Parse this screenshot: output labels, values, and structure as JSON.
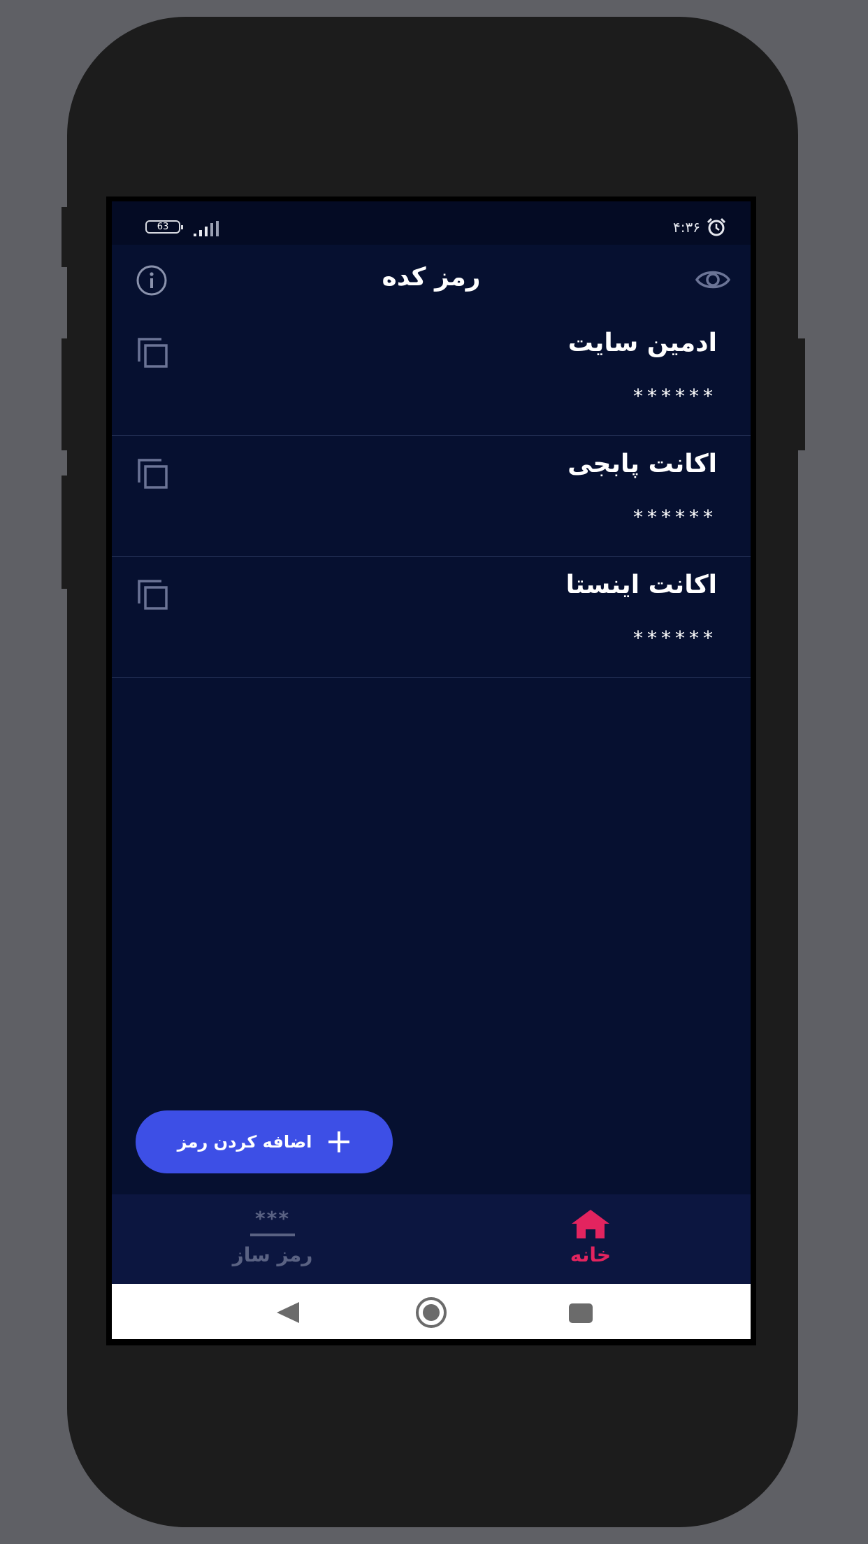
{
  "status_bar": {
    "battery": "63",
    "time": "۴:۳۶",
    "alarm_icon": "alarm-icon",
    "signal_icon": "signal-bars-icon"
  },
  "app_bar": {
    "title": "رمز کده",
    "left_icon": "info-icon",
    "right_icon": "eye-icon"
  },
  "items": [
    {
      "title": "ادمین سایت",
      "password": "******",
      "icon": "copy-icon"
    },
    {
      "title": "اکانت پابجی",
      "password": "******",
      "icon": "copy-icon"
    },
    {
      "title": "اکانت اینستا",
      "password": "******",
      "icon": "copy-icon"
    }
  ],
  "fab": {
    "label": "اضافه کردن رمز",
    "icon": "plus-icon"
  },
  "bottom_nav": {
    "home": {
      "label": "خانه",
      "icon": "home-icon",
      "active": true
    },
    "generator": {
      "label": "رمز ساز",
      "symbol": "***",
      "active": false
    }
  },
  "colors": {
    "background": "#061030",
    "status_bar": "#040b24",
    "nav_bar": "#0c1640",
    "fab": "#3d4fe6",
    "accent_active": "#e3245f",
    "inactive": "#5a6283",
    "divider": "#27345a"
  }
}
